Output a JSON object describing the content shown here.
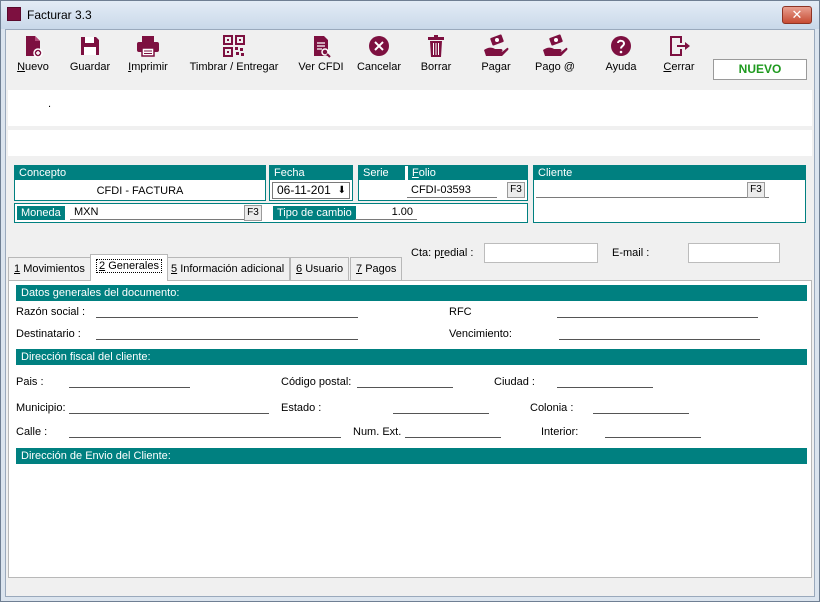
{
  "window": {
    "title": "Facturar 3.3",
    "close_glyph": "✕"
  },
  "toolbar": [
    {
      "key": "nuevo",
      "label": "Nuevo",
      "hotkey": "N",
      "icon": "new-document-icon",
      "color": "#7d1040"
    },
    {
      "key": "guardar",
      "label": "Guardar",
      "icon": "save-disk-icon",
      "color": "#7d1040"
    },
    {
      "key": "imprimir",
      "label": "Imprimir",
      "hotkey": "I",
      "icon": "printer-icon",
      "color": "#7d1040"
    },
    {
      "key": "timbrar",
      "label": "Timbrar / Entregar",
      "icon": "qr-code-icon",
      "color": "#7d1040"
    },
    {
      "key": "vercfdi",
      "label": "Ver CFDI",
      "icon": "view-document-icon",
      "color": "#7d1040"
    },
    {
      "key": "cancelar",
      "label": "Cancelar",
      "icon": "cancel-circle-icon",
      "color": "#7d1040"
    },
    {
      "key": "borrar",
      "label": "Borrar",
      "icon": "trash-icon",
      "color": "#7d1040"
    },
    {
      "key": "pagar",
      "label": "Pagar",
      "icon": "pay-hand-icon",
      "color": "#7d1040"
    },
    {
      "key": "pagoe",
      "label": "Pago @",
      "icon": "epay-hand-icon",
      "color": "#7d1040"
    },
    {
      "key": "ayuda",
      "label": "Ayuda",
      "icon": "help-circle-icon",
      "color": "#7d1040"
    },
    {
      "key": "cerrar",
      "label": "Cerrar",
      "hotkey": "C",
      "icon": "exit-door-icon",
      "color": "#7d1040"
    }
  ],
  "status": {
    "text": "NUEVO",
    "color": "#1f9a1f"
  },
  "info": {
    "dot": "."
  },
  "header": {
    "concepto": {
      "label": "Concepto",
      "value": "CFDI - FACTURA"
    },
    "fecha": {
      "label": "Fecha",
      "value": "06-11-201"
    },
    "serie": {
      "label": "Serie"
    },
    "folio": {
      "label": "Folio",
      "value": "CFDI-03593",
      "key": "F3"
    },
    "cliente": {
      "label": "Cliente",
      "value": "",
      "key": "F3"
    },
    "moneda": {
      "label": "Moneda",
      "value": "MXN",
      "key": "F3"
    },
    "tipo_cambio": {
      "label": "Tipo de cambio",
      "value": "1.00"
    }
  },
  "extra": {
    "cta_predial": {
      "label": "Cta: predial :",
      "value": ""
    },
    "email": {
      "label": "E-mail :",
      "value": ""
    }
  },
  "tabs": [
    {
      "num": "1",
      "label": "Movimientos",
      "active": false
    },
    {
      "num": "2",
      "label": "Generales",
      "active": true
    },
    {
      "num": "5",
      "label": "Información adicional",
      "active": false
    },
    {
      "num": "6",
      "label": "Usuario",
      "active": false
    },
    {
      "num": "7",
      "label": "Pagos",
      "active": false
    }
  ],
  "generales": {
    "section1": "Datos generales del documento:",
    "razon_social": "Razón social :",
    "rfc": "RFC",
    "destinatario": "Destinatario :",
    "vencimiento": "Vencimiento:",
    "section2": "Dirección fiscal del cliente:",
    "pais": "Pais :",
    "codigo_postal": "Código postal:",
    "ciudad": "Ciudad :",
    "municipio": "Municipio:",
    "estado": "Estado :",
    "colonia": "Colonia :",
    "calle": "Calle :",
    "num_ext": "Num. Ext.",
    "interior": "Interior:",
    "section3": "Dirección de Envio del Cliente:"
  },
  "theme": {
    "teal": "#008080",
    "maroon": "#7d1040"
  }
}
